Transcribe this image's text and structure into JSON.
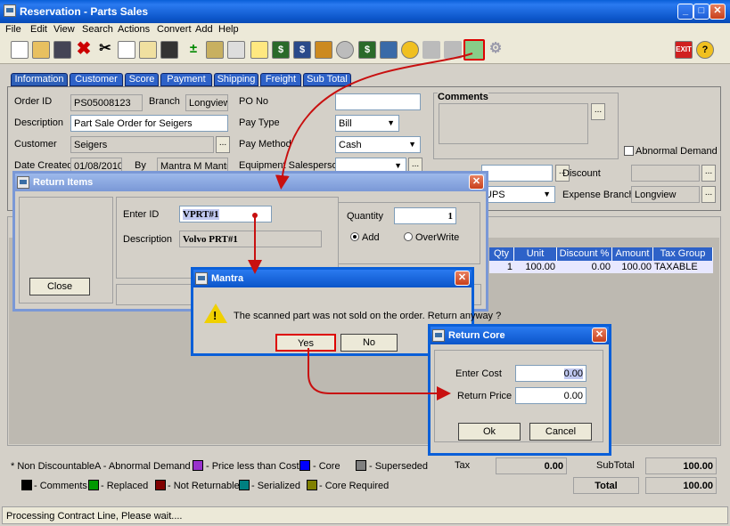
{
  "window": {
    "title": "Reservation - Parts Sales",
    "min": "_",
    "max": "□",
    "close": "✕"
  },
  "menu": [
    "File",
    "Edit",
    "View",
    "Search",
    "Actions",
    "Convert",
    "Add",
    "Help"
  ],
  "tabs": [
    "Information",
    "Customer",
    "Score",
    "Payment",
    "Shipping",
    "Freight",
    "Sub Total"
  ],
  "info": {
    "order_id_label": "Order ID",
    "order_id": "PS05008123",
    "branch_label": "Branch",
    "branch": "Longview",
    "po_label": "PO No",
    "po": "",
    "description_label": "Description",
    "description": "Part Sale Order for Seigers",
    "pay_type_label": "Pay Type",
    "pay_type": "Bill",
    "customer_label": "Customer",
    "customer": "Seigers",
    "pay_method_label": "Pay Method",
    "pay_method": "Cash",
    "date_label": "Date Created",
    "date": "01/08/2010",
    "by_label": "By",
    "by": "Mantra M Mantra",
    "equip_label": "Equipment Salesperson",
    "comments_label": "Comments",
    "abnormal_label": "Abnormal Demand",
    "discount_label": "Discount",
    "ship_via": "UPS",
    "expense_label": "Expense Branch",
    "expense": "Longview"
  },
  "grid": {
    "headers": [
      "Qty",
      "Unit Price",
      "Discount %",
      "Amount",
      "Tax Group"
    ],
    "row": [
      "1",
      "100.00",
      "0.00",
      "100.00",
      "TAXABLE"
    ]
  },
  "legend": {
    "non_discountable": "* Non Discountable",
    "abnormal": "A - Abnormal Demand",
    "price_less": "- Price less than Cost",
    "core": "- Core",
    "superseded": "- Superseded",
    "comments": "- Comments",
    "replaced": "- Replaced",
    "not_returnable": "- Not Returnable",
    "serialized": "- Serialized",
    "core_required": "- Core Required"
  },
  "colors": {
    "price_less": "#9933cc",
    "core": "#0000ff",
    "superseded": "#808080",
    "comments": "#000000",
    "replaced": "#009900",
    "not_returnable": "#800000",
    "serialized": "#008080",
    "core_required": "#808000"
  },
  "totals": {
    "tax_label": "Tax",
    "tax": "0.00",
    "subtotal_label": "SubTotal",
    "subtotal": "100.00",
    "total_label": "Total",
    "total": "100.00"
  },
  "status": "Processing Contract Line, Please wait....",
  "return_items": {
    "title": "Return Items",
    "close_label": "Close",
    "enter_id_label": "Enter ID",
    "enter_id": "VPRT#1",
    "description_label": "Description",
    "description": "Volvo PRT#1",
    "quantity_label": "Quantity",
    "quantity": "1",
    "add_label": "Add",
    "overwrite_label": "OverWrite"
  },
  "mantra": {
    "title": "Mantra",
    "message": "The scanned part was not sold on the order. Return anyway ?",
    "yes": "Yes",
    "no": "No"
  },
  "return_core": {
    "title": "Return Core",
    "cost_label": "Enter Cost",
    "cost": "0.00",
    "price_label": "Return Price",
    "price": "0.00",
    "ok": "Ok",
    "cancel": "Cancel"
  }
}
